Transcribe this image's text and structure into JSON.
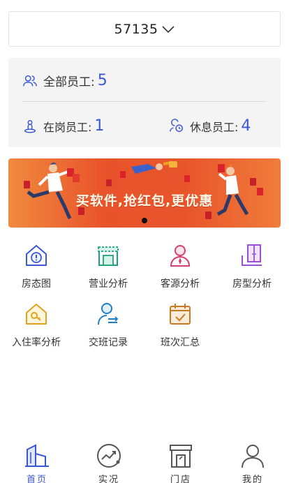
{
  "store_selector": {
    "value": "57135"
  },
  "staff": {
    "total_label": "全部员工:",
    "total_count": "5",
    "on_duty_label": "在岗员工:",
    "on_duty_count": "1",
    "resting_label": "休息员工:",
    "resting_count": "4"
  },
  "banner": {
    "text": "买软件,抢红包,更优惠"
  },
  "menu": [
    {
      "label": "房态图",
      "icon": "house-alert-icon"
    },
    {
      "label": "营业分析",
      "icon": "storefront-icon"
    },
    {
      "label": "客源分析",
      "icon": "guest-person-icon"
    },
    {
      "label": "房型分析",
      "icon": "door-wardrobe-icon"
    },
    {
      "label": "入住率分析",
      "icon": "house-key-icon"
    },
    {
      "label": "交班记录",
      "icon": "handover-person-icon"
    },
    {
      "label": "班次汇总",
      "icon": "calendar-check-icon"
    }
  ],
  "tabbar": [
    {
      "label": "首页",
      "icon": "buildings-icon",
      "active": true
    },
    {
      "label": "实况",
      "icon": "trend-chart-icon",
      "active": false
    },
    {
      "label": "门店",
      "icon": "store-icon",
      "active": false
    },
    {
      "label": "我的",
      "icon": "user-icon",
      "active": false
    }
  ],
  "colors": {
    "accent": "#3a57d8",
    "banner": "#e8552c"
  }
}
